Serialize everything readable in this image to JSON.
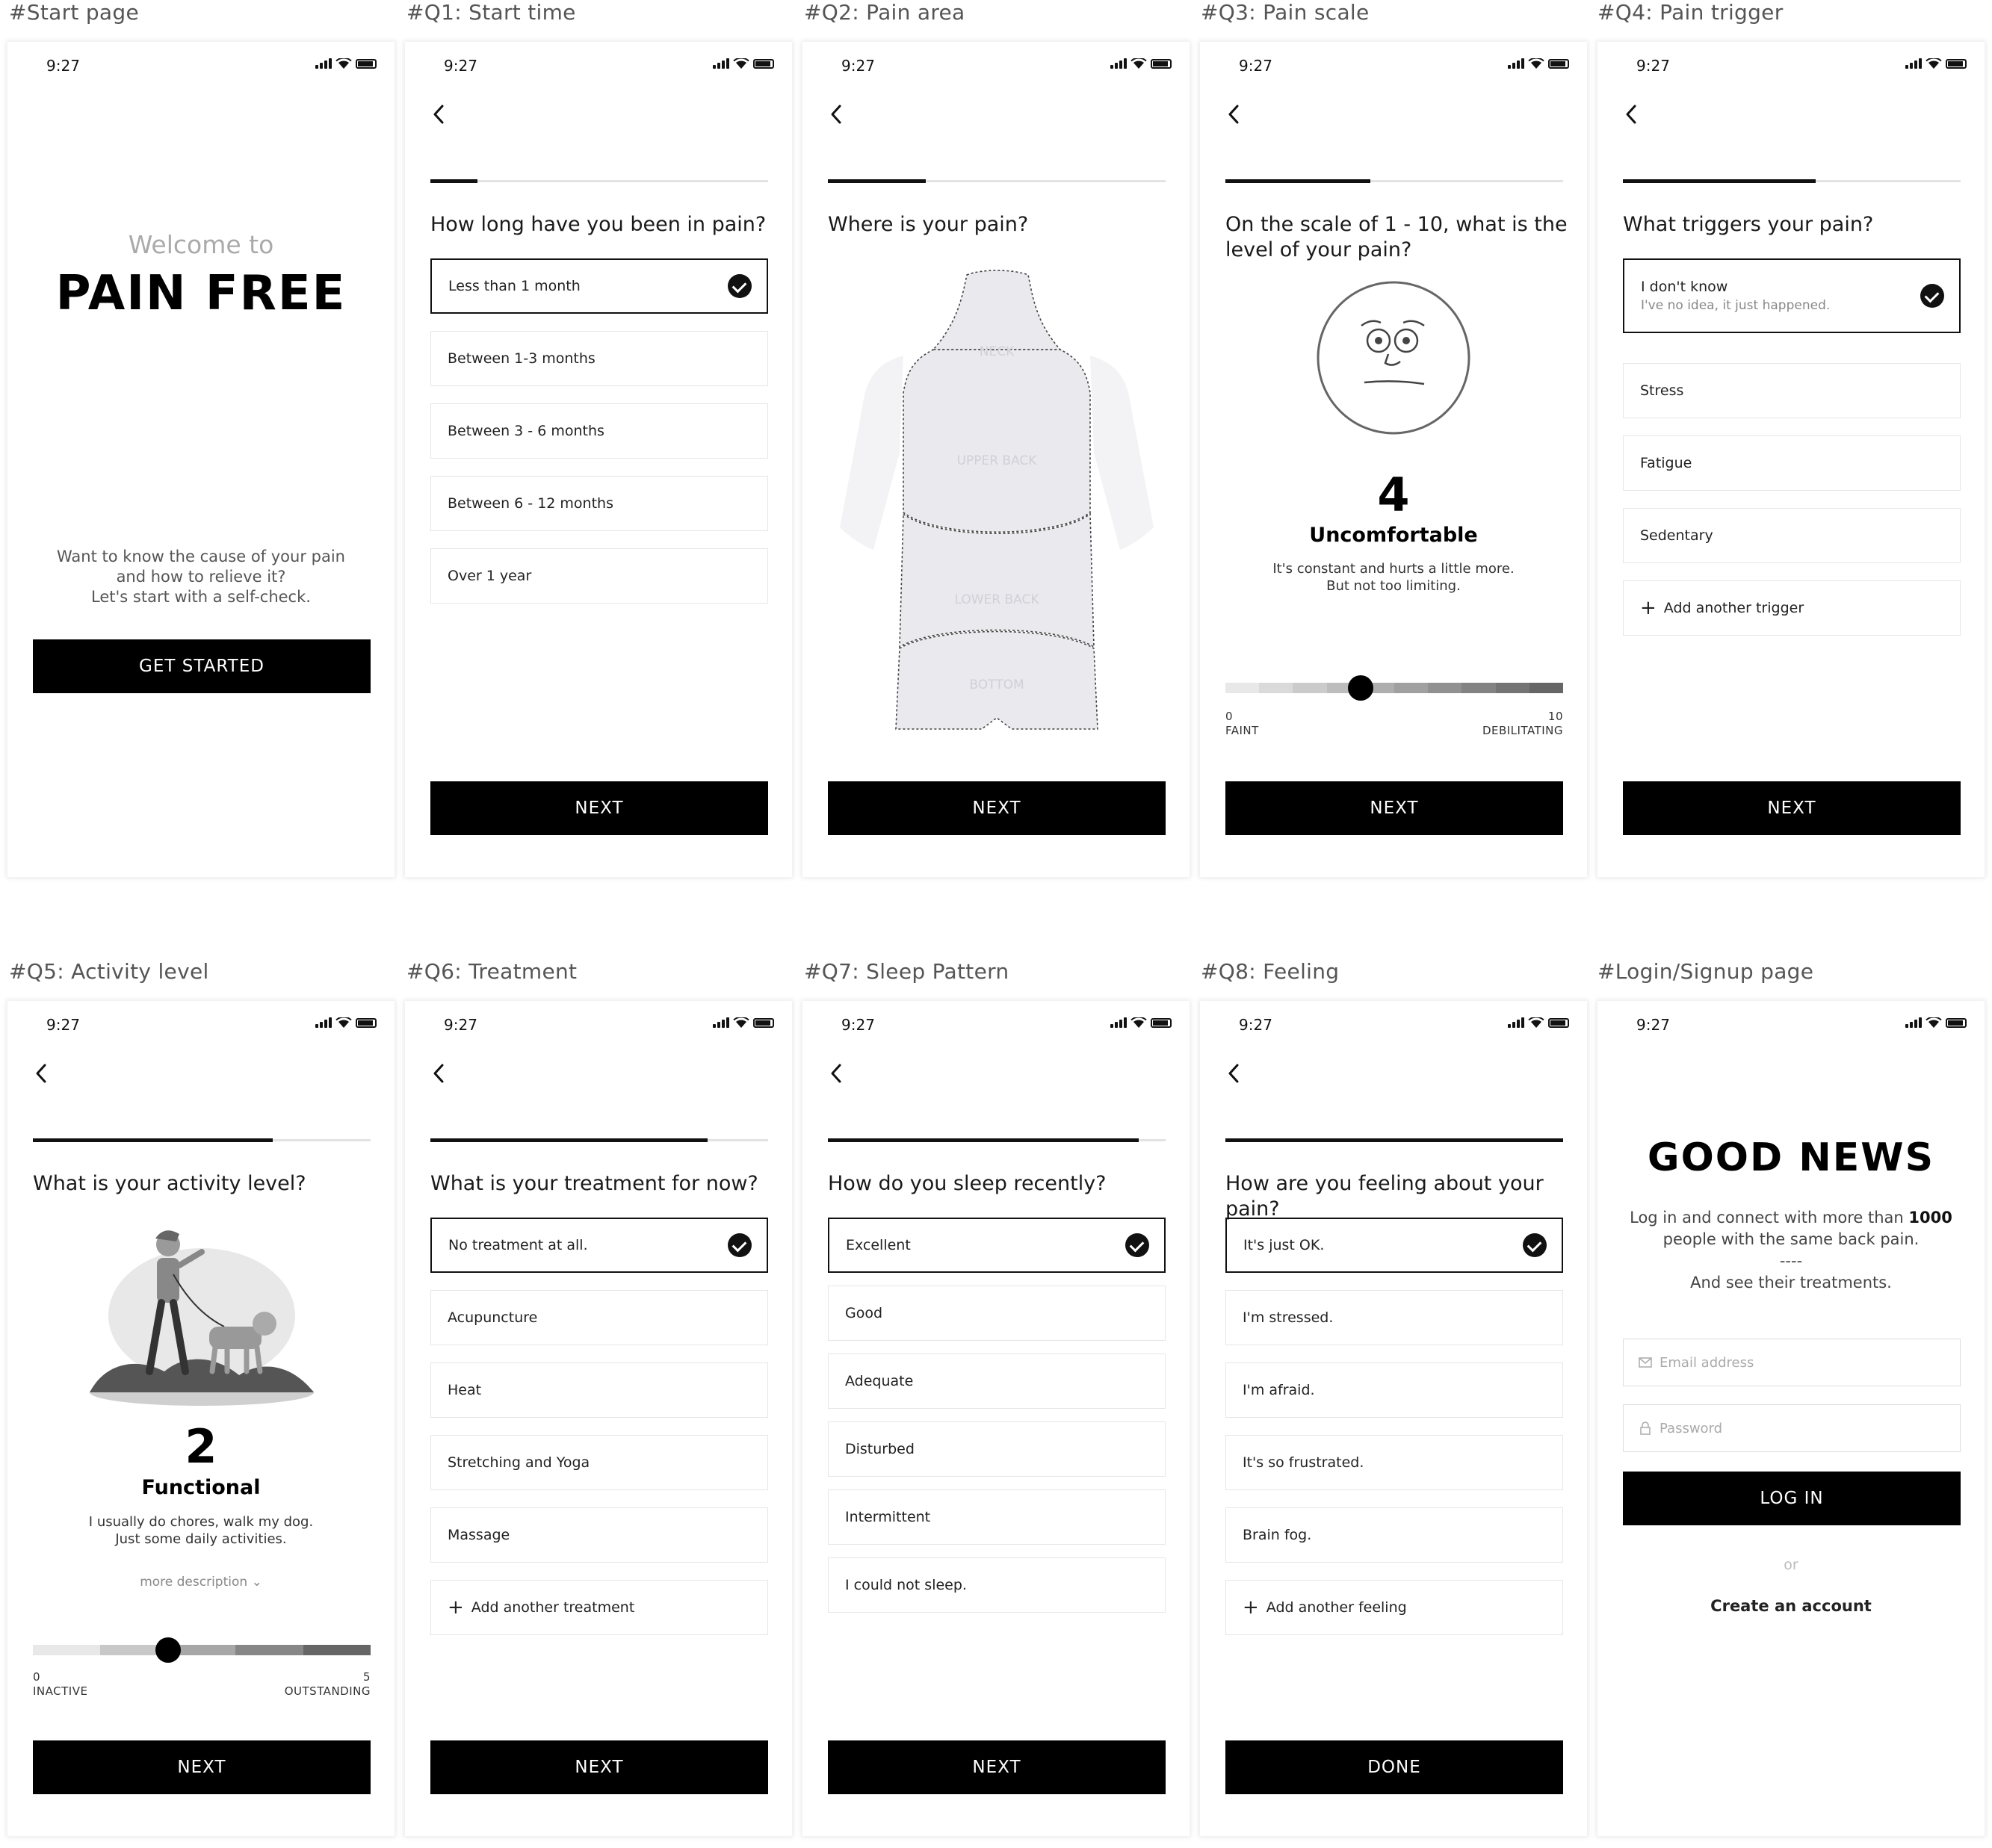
{
  "status_time": "9:27",
  "captions": [
    "#Start page",
    "#Q1: Start time",
    "#Q2: Pain area",
    "#Q3: Pain scale",
    "#Q4: Pain trigger",
    "#Q5: Activity level",
    "#Q6: Treatment",
    "#Q7: Sleep Pattern",
    "#Q8: Feeling",
    "#Login/Signup page"
  ],
  "start": {
    "welcome": "Welcome to",
    "brand": "PAIN FREE",
    "desc1": "Want to know the cause of your pain",
    "desc2": "and how to relieve it?",
    "desc3": "Let's start with a self-check.",
    "button": "GET STARTED"
  },
  "q1": {
    "progress": 0.14,
    "question": "How long have you been in pain?",
    "options": [
      "Less than 1 month",
      "Between 1-3 months",
      "Between 3 - 6 months",
      "Between 6 - 12 months",
      "Over 1 year"
    ],
    "button": "NEXT"
  },
  "q2": {
    "progress": 0.29,
    "question": "Where is your pain?",
    "areas": [
      "NECK",
      "UPPER BACK",
      "LOWER BACK",
      "BOTTOM"
    ],
    "button": "NEXT"
  },
  "q3": {
    "progress": 0.43,
    "question": "On the scale of 1 - 10, what is the level of your pain?",
    "value": "4",
    "label": "Uncomfortable",
    "desc1": "It's constant and hurts a little more.",
    "desc2": "But not too limiting.",
    "min": "0",
    "max": "10",
    "min_label": "FAINT",
    "max_label": "DEBILITATING",
    "button": "NEXT"
  },
  "q4": {
    "progress": 0.57,
    "question": "What triggers your pain?",
    "selected_title": "I don't know",
    "selected_sub": "I've no idea, it just happened.",
    "options": [
      "Stress",
      "Fatigue",
      "Sedentary"
    ],
    "add": "Add another trigger",
    "button": "NEXT"
  },
  "q5": {
    "progress": 0.71,
    "question": "What is your activity level?",
    "value": "2",
    "label": "Functional",
    "desc1": "I usually do chores, walk my dog.",
    "desc2": "Just some daily activities.",
    "more": "more description",
    "min": "0",
    "max": "5",
    "min_label": "INACTIVE",
    "max_label": "OUTSTANDING",
    "button": "NEXT"
  },
  "q6": {
    "progress": 0.82,
    "question": "What is your treatment for now?",
    "options": [
      "No treatment at all.",
      "Acupuncture",
      "Heat",
      "Stretching and Yoga",
      "Massage"
    ],
    "add": "Add another treatment",
    "button": "NEXT"
  },
  "q7": {
    "progress": 0.92,
    "question": "How do you sleep recently?",
    "options": [
      "Excellent",
      "Good",
      "Adequate",
      "Disturbed",
      "Intermittent",
      "I could not sleep."
    ],
    "button": "NEXT"
  },
  "q8": {
    "progress": 1.0,
    "question": "How are you feeling about your pain?",
    "options": [
      "It's just OK.",
      "I'm stressed.",
      "I'm afraid.",
      "It's so frustrated.",
      "Brain fog."
    ],
    "add": "Add another feeling",
    "button": "DONE"
  },
  "login": {
    "title": "GOOD NEWS",
    "line1a": "Log in and  connect with more than ",
    "line1b": "1000",
    "line2": "people with the same back pain.",
    "divider": "----",
    "line3": "And see their treatments.",
    "email_placeholder": "Email address",
    "password_placeholder": "Password",
    "button": "LOG IN",
    "or": "or",
    "create": "Create an account"
  },
  "colors": {
    "accent": "#000000",
    "border": "#e6e6e6",
    "muted": "#aaaaaa"
  }
}
